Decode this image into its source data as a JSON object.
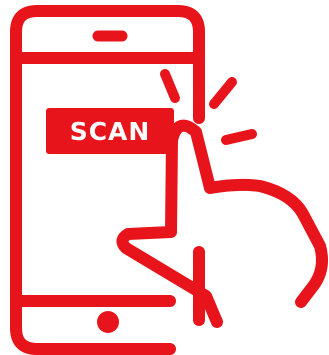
{
  "icon": {
    "name": "scan-phone-icon",
    "accent_color": "#e8141b",
    "badge_text": "SCAN"
  }
}
